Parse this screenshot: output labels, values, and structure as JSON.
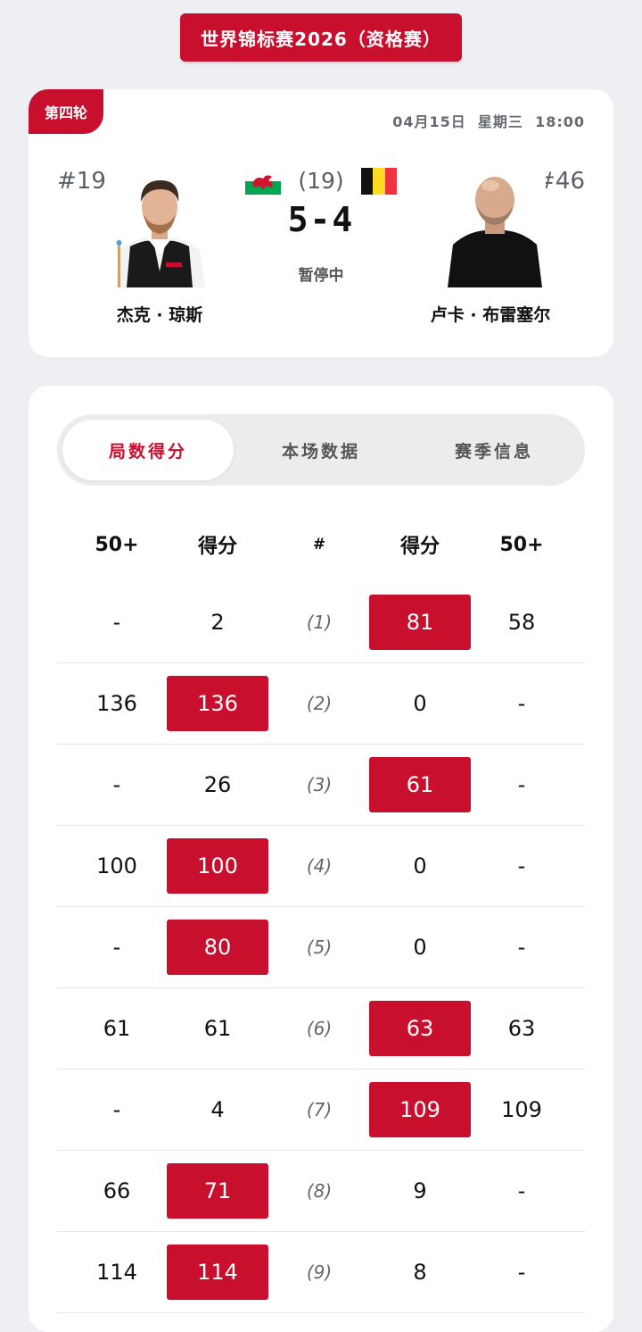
{
  "header": {
    "tournament_title": "世界锦标赛2026（资格赛）"
  },
  "match": {
    "round": "第四轮",
    "datetime": "04月15日  星期三  18:00",
    "frames_total": "(19)",
    "score": "5-4",
    "status": "暂停中",
    "player_left": {
      "rank": "#19",
      "name": "杰克 · 琼斯",
      "flag": "wales-flag-icon"
    },
    "player_right": {
      "rank": "#46",
      "name": "卢卡 · 布雷塞尔",
      "flag": "belgium-flag-icon"
    }
  },
  "tabs": [
    {
      "label": "局数得分",
      "active": true
    },
    {
      "label": "本场数据",
      "active": false
    },
    {
      "label": "赛季信息",
      "active": false
    }
  ],
  "table": {
    "headers": [
      "50+",
      "得分",
      "#",
      "得分",
      "50+"
    ],
    "rows": [
      {
        "l50": "-",
        "lscore": "2",
        "frame": "(1)",
        "rscore": "81",
        "r50": "58",
        "winner": "right"
      },
      {
        "l50": "136",
        "lscore": "136",
        "frame": "(2)",
        "rscore": "0",
        "r50": "-",
        "winner": "left"
      },
      {
        "l50": "-",
        "lscore": "26",
        "frame": "(3)",
        "rscore": "61",
        "r50": "-",
        "winner": "right"
      },
      {
        "l50": "100",
        "lscore": "100",
        "frame": "(4)",
        "rscore": "0",
        "r50": "-",
        "winner": "left"
      },
      {
        "l50": "-",
        "lscore": "80",
        "frame": "(5)",
        "rscore": "0",
        "r50": "-",
        "winner": "left"
      },
      {
        "l50": "61",
        "lscore": "61",
        "frame": "(6)",
        "rscore": "63",
        "r50": "63",
        "winner": "right"
      },
      {
        "l50": "-",
        "lscore": "4",
        "frame": "(7)",
        "rscore": "109",
        "r50": "109",
        "winner": "right"
      },
      {
        "l50": "66",
        "lscore": "71",
        "frame": "(8)",
        "rscore": "9",
        "r50": "-",
        "winner": "left"
      },
      {
        "l50": "114",
        "lscore": "114",
        "frame": "(9)",
        "rscore": "8",
        "r50": "-",
        "winner": "left"
      }
    ]
  },
  "colors": {
    "accent": "#c8102e",
    "background": "#eeeff2",
    "card": "#ffffff"
  }
}
